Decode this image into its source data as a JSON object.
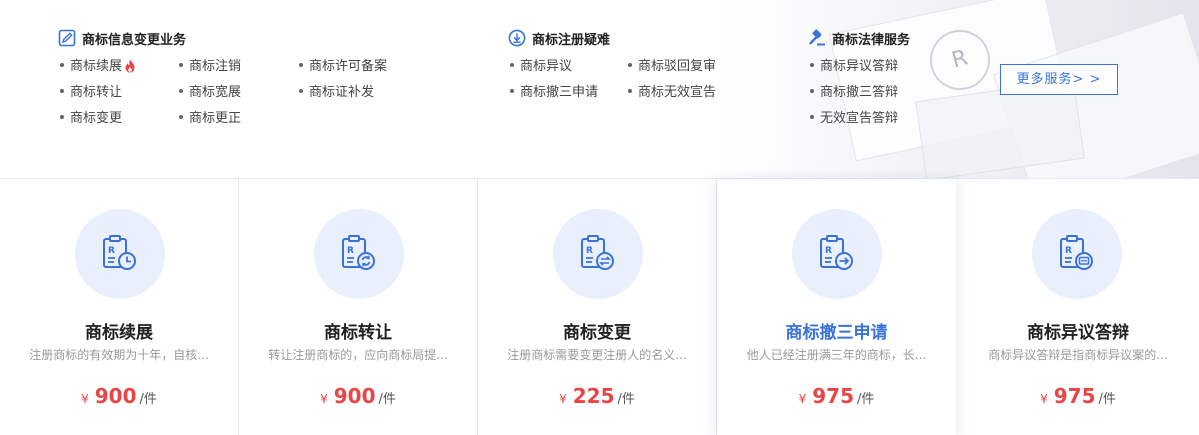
{
  "groups": [
    {
      "title": "商标信息变更业务",
      "icon": "edit-icon",
      "links": [
        "商标续展",
        "商标注销",
        "商标许可备案",
        "商标转让",
        "商标宽展",
        "商标证补发",
        "商标变更",
        "商标更正"
      ]
    },
    {
      "title": "商标注册疑难",
      "icon": "download-icon",
      "links": [
        "商标异议",
        "商标驳回复审",
        "商标撤三申请",
        "商标无效宣告"
      ]
    },
    {
      "title": "商标法律服务",
      "icon": "gavel-icon",
      "links": [
        "商标异议答辩",
        "商标撤三答辩",
        "无效宣告答辩"
      ]
    }
  ],
  "hot_badge_icon": "fire-icon",
  "more_button": "更多服务> >",
  "background_seal_letter": "R",
  "cards": [
    {
      "title": "商标续展",
      "desc": "注册商标的有效期为十年，自核...",
      "currency": "¥",
      "price": "900",
      "unit": "/件",
      "icon": "renew-clock-icon"
    },
    {
      "title": "商标转让",
      "desc": "转让注册商标的，应向商标局提...",
      "currency": "¥",
      "price": "900",
      "unit": "/件",
      "icon": "transfer-cycle-icon"
    },
    {
      "title": "商标变更",
      "desc": "注册商标需要变更注册人的名义...",
      "currency": "¥",
      "price": "225",
      "unit": "/件",
      "icon": "change-arrows-icon"
    },
    {
      "title": "商标撤三申请",
      "desc": "他人已经注册满三年的商标，长...",
      "currency": "¥",
      "price": "975",
      "unit": "/件",
      "icon": "revoke-arrow-icon"
    },
    {
      "title": "商标异议答辩",
      "desc": "商标异议答辩是指商标异议案的...",
      "currency": "¥",
      "price": "975",
      "unit": "/件",
      "icon": "reply-chat-icon"
    }
  ],
  "colors": {
    "accent": "#3a73d7",
    "price": "#e84545",
    "icon_bg": "#e9effb"
  }
}
